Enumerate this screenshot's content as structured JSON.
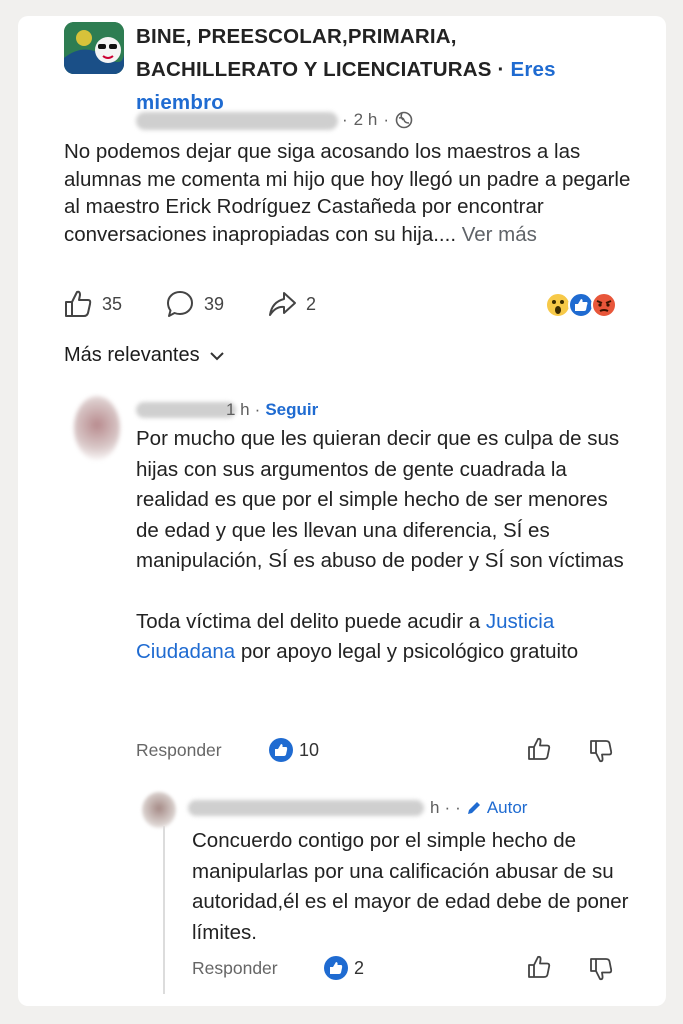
{
  "post": {
    "group_name": "BINE, PREESCOLAR,PRIMARIA, BACHILLERATO Y LICENCIATURAS",
    "member_label": "Eres miembro",
    "time": "2 h",
    "text": "No podemos dejar que siga acosando los maestros a las alumnas me comenta mi hijo que hoy llegó un padre a pegarle al maestro Erick Rodríguez Castañeda por encontrar conversaciones inapropiadas con su hija....",
    "see_more": "Ver más",
    "likes": "35",
    "comments": "39",
    "shares": "2",
    "reactions": [
      "wow-emoji-icon",
      "like-emoji-icon",
      "angry-emoji-icon"
    ]
  },
  "sort": {
    "label": "Más relevantes"
  },
  "comment": {
    "time": "1 h",
    "follow": "Seguir",
    "text_p1": "Por mucho que les quieran decir que es culpa de sus hijas con sus argumentos de gente cuadrada la realidad es que por el simple hecho de ser menores de edad y que les llevan una diferencia, SÍ es manipulación, SÍ es abuso de poder y SÍ son víctimas",
    "text_p2_before": "Toda víctima del delito puede acudir a ",
    "text_p2_link": "Justicia Ciudadana",
    "text_p2_after": " por apoyo legal y psicológico gratuito",
    "reply_label": "Responder",
    "reaction_count": "10"
  },
  "reply": {
    "time": "h",
    "author_badge": "Autor",
    "text": "Concuerdo contigo por el simple hecho de manipularlas por una calificación abusar de su autoridad,él es el mayor de edad debe de poner límites.",
    "reply_label": "Responder",
    "reaction_count": "2"
  },
  "colors": {
    "accent": "#1f6bd1",
    "text": "#222222",
    "muted": "#666666"
  }
}
